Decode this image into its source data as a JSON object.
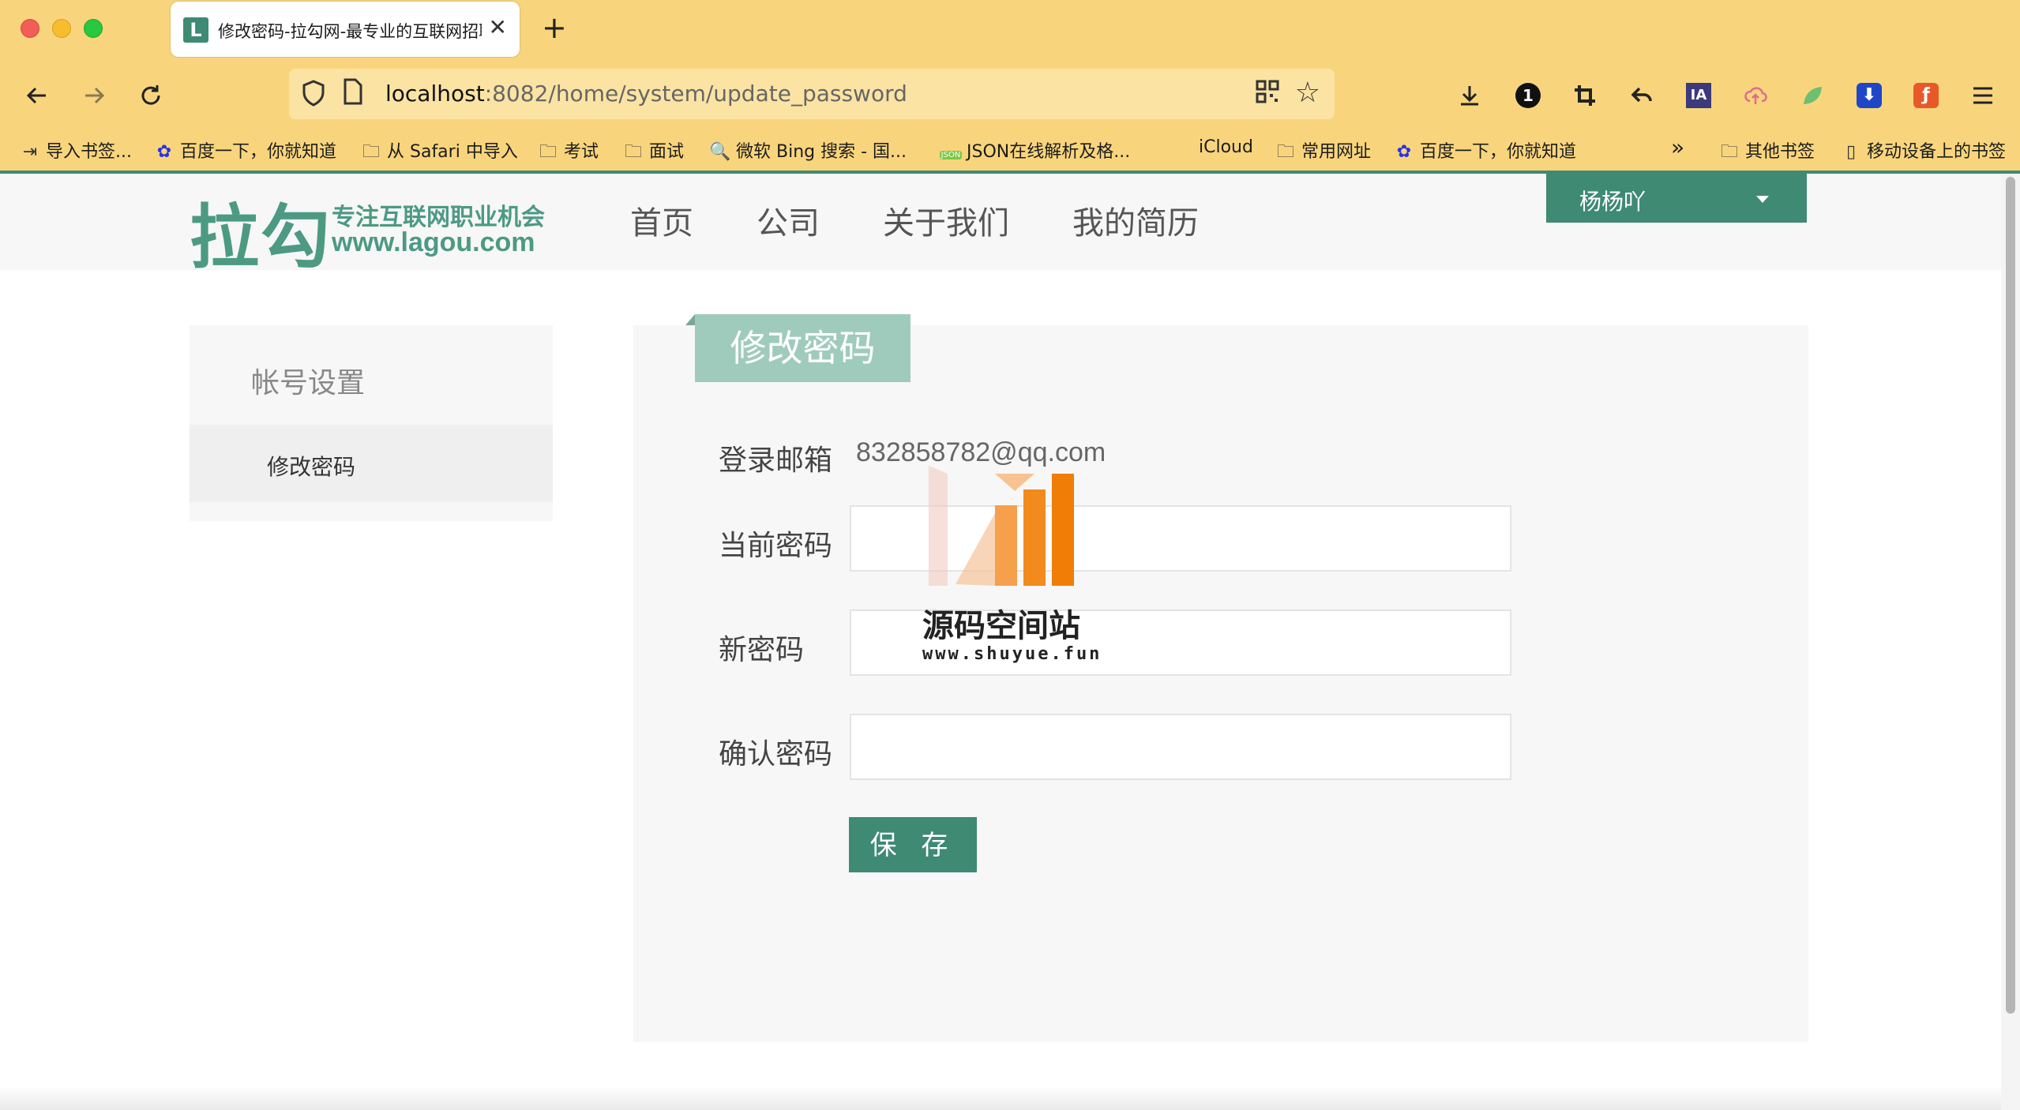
{
  "browser": {
    "tab_title": "修改密码-拉勾网-最专业的互联网招聘平台",
    "tab_favicon_letter": "L",
    "url_host": "localhost",
    "url_rest": ":8082/home/system/update_password",
    "bookmarks": [
      {
        "label": "导入书签...",
        "icon": "import-icon"
      },
      {
        "label": "百度一下，你就知道",
        "icon": "baidu-paw-icon"
      },
      {
        "label": "从 Safari 中导入",
        "icon": "folder-icon"
      },
      {
        "label": "考试",
        "icon": "folder-icon"
      },
      {
        "label": "面试",
        "icon": "folder-icon"
      },
      {
        "label": "微软 Bing 搜索 - 国...",
        "icon": "search-icon"
      },
      {
        "label": "JSON在线解析及格...",
        "icon": "json-icon"
      },
      {
        "label": "iCloud",
        "icon": "apple-icon"
      },
      {
        "label": "常用网址",
        "icon": "folder-icon"
      },
      {
        "label": "百度一下，你就知道",
        "icon": "baidu-paw-icon"
      },
      {
        "label": "其他书签",
        "icon": "folder-icon"
      },
      {
        "label": "移动设备上的书签",
        "icon": "mobile-icon"
      }
    ],
    "badge_count": "1"
  },
  "site": {
    "logo_main": "拉勾",
    "logo_slogan": "专注互联网职业机会",
    "logo_url": "www.lagou.com",
    "nav": [
      "首页",
      "公司",
      "关于我们",
      "我的简历"
    ],
    "user_name": "杨杨吖"
  },
  "sidebar": {
    "title": "帐号设置",
    "items": [
      "修改密码"
    ]
  },
  "form": {
    "title": "修改密码",
    "email_label": "登录邮箱",
    "email_value": "832858782@qq.com",
    "current_password_label": "当前密码",
    "new_password_label": "新密码",
    "confirm_password_label": "确认密码",
    "current_password_value": "",
    "new_password_value": "",
    "confirm_password_value": "",
    "save_label": "保 存"
  },
  "watermark": {
    "text": "源码空间站",
    "url": "www.shuyue.fun"
  },
  "colors": {
    "chrome": "#f8d57d",
    "brand_green": "#3e8a73",
    "title_green": "#9fcbbd"
  }
}
